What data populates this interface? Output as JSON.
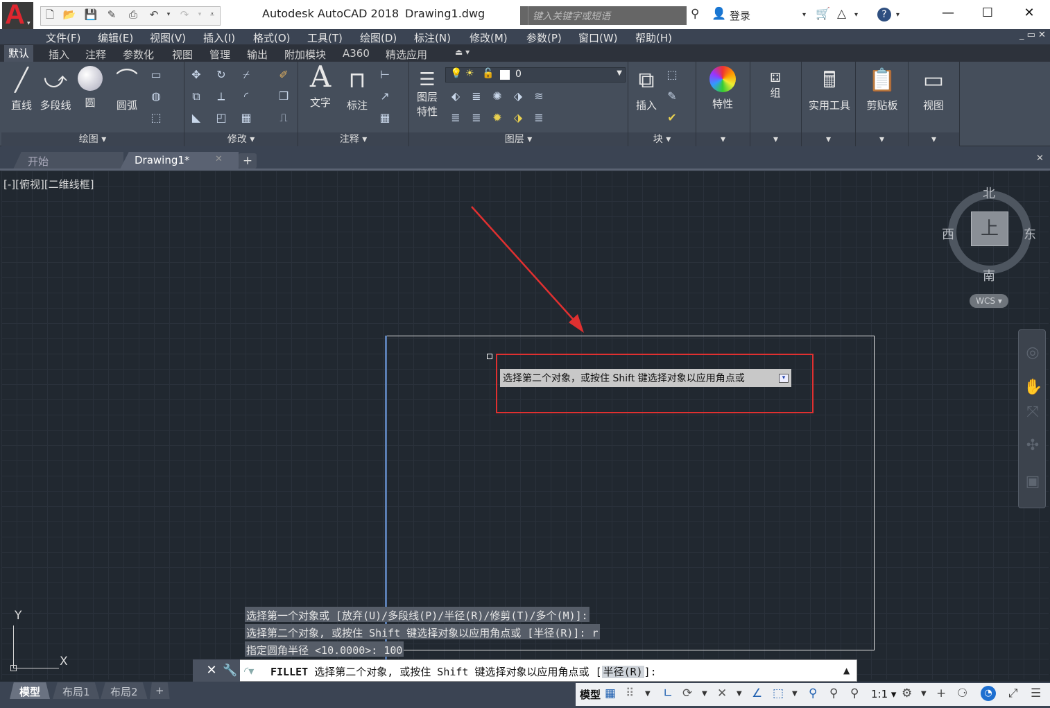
{
  "window": {
    "app_title": "Autodesk AutoCAD 2018",
    "doc_title": "Drawing1.dwg",
    "search_placeholder": "键入关键字或短语",
    "login": "登录"
  },
  "menu": [
    "文件(F)",
    "编辑(E)",
    "视图(V)",
    "插入(I)",
    "格式(O)",
    "工具(T)",
    "绘图(D)",
    "标注(N)",
    "修改(M)",
    "参数(P)",
    "窗口(W)",
    "帮助(H)"
  ],
  "ribbon_tabs": [
    "默认",
    "插入",
    "注释",
    "参数化",
    "视图",
    "管理",
    "输出",
    "附加模块",
    "A360",
    "精选应用"
  ],
  "ribbon": {
    "draw": {
      "line": "直线",
      "polyline": "多段线",
      "circle": "圆",
      "arc": "圆弧",
      "panel": "绘图"
    },
    "modify": {
      "panel": "修改"
    },
    "annotation": {
      "text": "文字",
      "dimension": "标注",
      "panel": "注释"
    },
    "layers": {
      "layer_props_1": "图层",
      "layer_props_2": "特性",
      "current_layer": "0",
      "panel": "图层"
    },
    "block": {
      "insert": "插入",
      "panel": "块"
    },
    "properties": {
      "label": "特性"
    },
    "groups": {
      "label": "组"
    },
    "utilities": {
      "label": "实用工具"
    },
    "clipboard": {
      "label": "剪贴板"
    },
    "view": {
      "label": "视图"
    }
  },
  "file_tabs": {
    "start": "开始",
    "drawing": "Drawing1*"
  },
  "viewport": {
    "label": "[-][俯视][二维线框]"
  },
  "viewcube": {
    "north": "北",
    "south": "南",
    "east": "东",
    "west": "西",
    "face": "上",
    "wcs": "WCS"
  },
  "ucs": {
    "x": "X",
    "y": "Y"
  },
  "tooltip": {
    "text": "选择第二个对象，或按住 Shift 键选择对象以应用角点或"
  },
  "command_history": [
    "选择第一个对象或 [放弃(U)/多段线(P)/半径(R)/修剪(T)/多个(M)]:",
    "选择第二个对象, 或按住 Shift 键选择对象以应用角点或 [半径(R)]: r",
    "指定圆角半径 <10.0000>: 100"
  ],
  "command_line": {
    "command": "FILLET",
    "prompt": "选择第二个对象, 或按住 Shift 键选择对象以应用角点或 [",
    "option": "半径(R)",
    "suffix": "]:"
  },
  "layout_tabs": [
    "模型",
    "布局1",
    "布局2"
  ],
  "status": {
    "model": "模型",
    "scale": "1:1"
  },
  "colors": {
    "annotation_red": "#e03030",
    "canvas_bg": "#212830",
    "ribbon_bg": "#454e5b",
    "autocad_red": "#e0262f"
  }
}
